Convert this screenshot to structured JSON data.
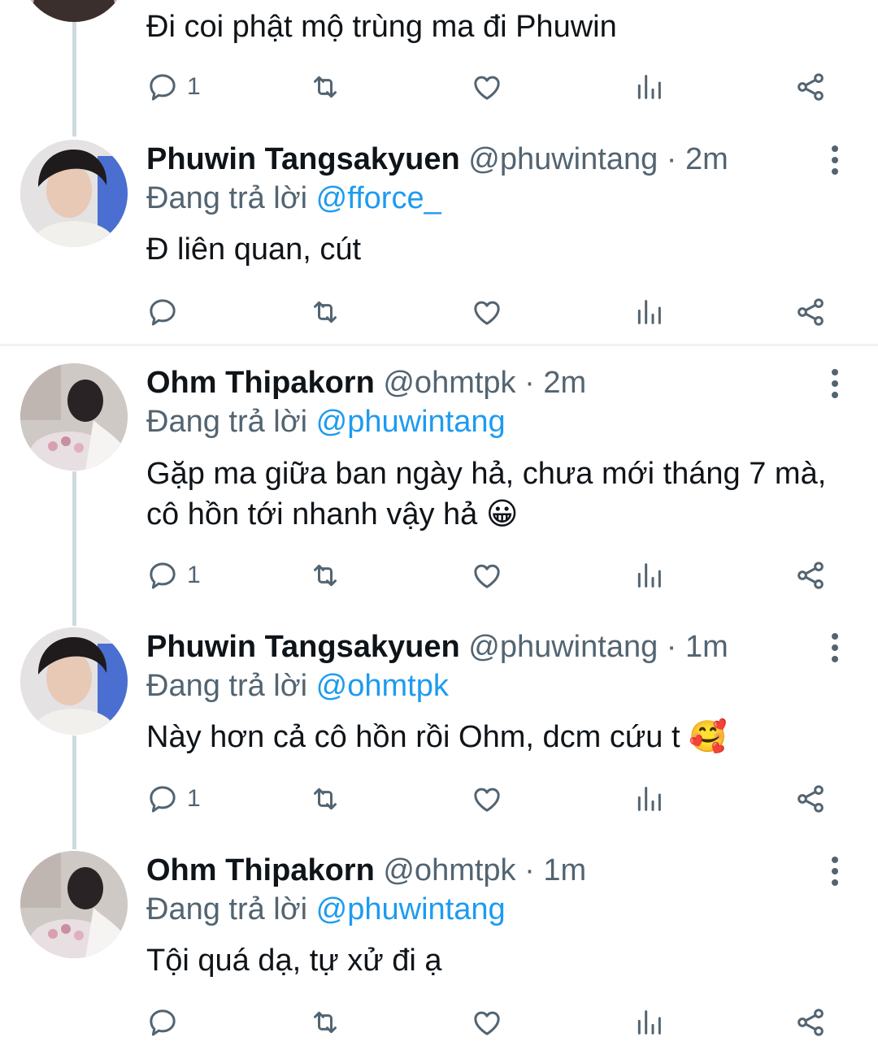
{
  "tweets": [
    {
      "text": "Đi coi phật mộ trùng ma đi Phuwin",
      "reply_count": "1"
    },
    {
      "name": "Phuwin Tangsakyuen",
      "handle": "@phuwintang",
      "time": "2m",
      "reply_prefix": "Đang trả lời",
      "reply_to": "@fforce_",
      "text": "Đ liên quan, cút",
      "reply_count": ""
    },
    {
      "name": "Ohm Thipakorn",
      "handle": "@ohmtpk",
      "time": "2m",
      "reply_prefix": "Đang trả lời",
      "reply_to": "@phuwintang",
      "text": "Gặp ma giữa ban ngày hả, chưa mới tháng 7 mà, cô hồn tới nhanh vậy hả 😀",
      "reply_count": "1"
    },
    {
      "name": "Phuwin Tangsakyuen",
      "handle": "@phuwintang",
      "time": "1m",
      "reply_prefix": "Đang trả lời",
      "reply_to": "@ohmtpk",
      "text": "Này hơn cả cô hồn rồi Ohm, dcm cứu t 🥰",
      "reply_count": "1"
    },
    {
      "name": "Ohm Thipakorn",
      "handle": "@ohmtpk",
      "time": "1m",
      "reply_prefix": "Đang trả lời",
      "reply_to": "@phuwintang",
      "text": "Tội quá dạ, tự xử đi ạ",
      "reply_count": ""
    }
  ],
  "icons": {
    "reply": "reply-icon",
    "retweet": "retweet-icon",
    "like": "like-icon",
    "analytics": "analytics-icon",
    "share": "share-icon",
    "more": "more-icon"
  },
  "colors": {
    "text": "#0f1419",
    "secondary": "#536471",
    "mention": "#1d9bf0",
    "thread_line": "#cfd9de",
    "divider": "#eff3f4"
  }
}
